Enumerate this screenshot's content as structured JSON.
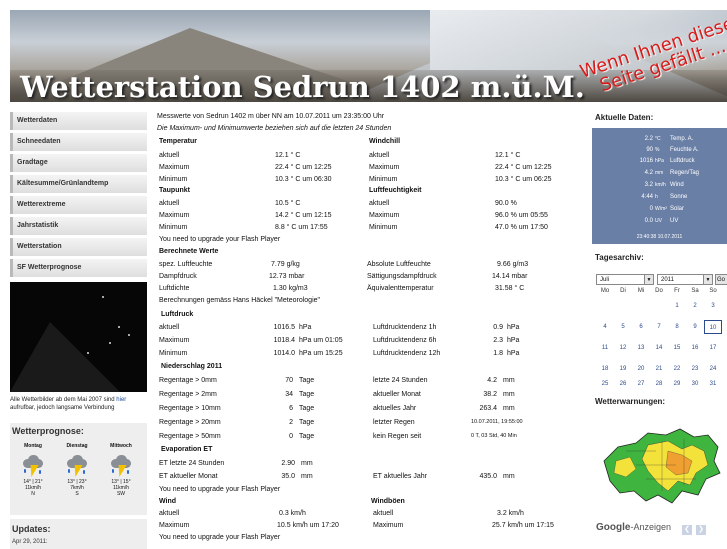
{
  "banner": {
    "title": "Wetterstation Sedrun 1402 m.ü.M.",
    "like_text": "Wenn Ihnen diese Seite gefällt ..."
  },
  "nav": [
    "Wetterdaten",
    "Schneedaten",
    "Gradtage",
    "Kältesumme/Grünlandtemp",
    "Wetterextreme",
    "Jahrstatistik",
    "Wetterstation",
    "SF Wetterprognose"
  ],
  "webcam": {
    "caption_pre": "Alle Wetterbilder ab dem Mai 2007 sind",
    "caption_link": "hier",
    "caption_post": "aufrufbar, jedoch langsame Verbindung"
  },
  "prognose": {
    "title": "Wetterprognose:",
    "days": [
      {
        "day": "Montag",
        "temp": "14° | 21°",
        "wind": "11km/h",
        "dir": "N"
      },
      {
        "day": "Dienstag",
        "temp": "13° | 23°",
        "wind": "7km/h",
        "dir": "S"
      },
      {
        "day": "Mittwoch",
        "temp": "13° | 15°",
        "wind": "11km/h",
        "dir": "SW"
      }
    ]
  },
  "updates": {
    "title": "Updates:",
    "date": "Apr 29, 2011:"
  },
  "main": {
    "intro1": "Messwerte von Sedrun 1402 m über NN am 10.07.2011 um 23:35:00 Uhr",
    "intro2": "Die Maximum- und Minimumwerte beziehen sich auf die letzten 24 Stunden",
    "flash": "You need to upgrade your Flash Player",
    "temperatur": {
      "h": "Temperatur",
      "rows": [
        [
          "aktuell",
          "12.1 ° C",
          ""
        ],
        [
          "Maximum",
          "22.4 ° C um 12:25",
          ""
        ],
        [
          "Minimum",
          "10.3 ° C um 06:30",
          ""
        ]
      ]
    },
    "windchill": {
      "h": "Windchill",
      "rows": [
        [
          "aktuell",
          "12.1 ° C"
        ],
        [
          "Maximum",
          "22.4 ° C um 12:25"
        ],
        [
          "Minimum",
          "10.3 ° C um 06:25"
        ]
      ]
    },
    "taupunkt": {
      "h": "Taupunkt",
      "rows": [
        [
          "aktuell",
          "10.5 ° C"
        ],
        [
          "Maximum",
          "14.2 ° C um 12:15"
        ],
        [
          "Minimum",
          "8.8 ° C um 17:55"
        ]
      ]
    },
    "feuchte": {
      "h": "Luftfeuchtigkeit",
      "rows": [
        [
          "aktuell",
          "90.0 %"
        ],
        [
          "Maximum",
          "96.0 % um 05:55"
        ],
        [
          "Minimum",
          "47.0 % um 17:50"
        ]
      ]
    },
    "berechnet": {
      "h": "Berechnete Werte",
      "left": [
        [
          "spez. Luftfeuchte",
          "7.79 g/kg"
        ],
        [
          "Dampfdruck",
          "12.73 mbar"
        ],
        [
          "Luftdichte",
          "1.30 kg/m3"
        ]
      ],
      "right": [
        [
          "Absolute Luftfeuchte",
          "9.66 g/m3"
        ],
        [
          "Sättigungsdampfdruck",
          "14.14 mbar"
        ],
        [
          "Äquivalenttemperatur",
          "31.58 ° C"
        ]
      ],
      "note": "Berechnungen gemäss Hans Häckel \"Meteorologie\""
    },
    "luftdruck": {
      "h": "Luftdruck",
      "left": [
        [
          "aktuell",
          "1016.5",
          "hPa"
        ],
        [
          "Maximum",
          "1018.4",
          "hPa um 01:05"
        ],
        [
          "Minimum",
          "1014.0",
          "hPa um 15:25"
        ]
      ],
      "right": [
        [
          "Luftdrucktendenz 1h",
          "0.9",
          "hPa"
        ],
        [
          "Luftdrucktendenz 6h",
          "2.3",
          "hPa"
        ],
        [
          "Luftdrucktendenz 12h",
          "1.8",
          "hPa"
        ]
      ]
    },
    "niederschlag": {
      "h": "Niederschlag 2011",
      "left": [
        [
          "Regentage > 0mm",
          "70",
          "Tage"
        ],
        [
          "Regentage > 2mm",
          "34",
          "Tage"
        ],
        [
          "Regentage > 10mm",
          "6",
          "Tage"
        ],
        [
          "Regentage > 20mm",
          "2",
          "Tage"
        ],
        [
          "Regentage > 50mm",
          "0",
          "Tage"
        ]
      ],
      "right": [
        [
          "letzte 24 Stunden",
          "4.2",
          "mm"
        ],
        [
          "aktueller Monat",
          "38.2",
          "mm"
        ],
        [
          "aktuelles Jahr",
          "263.4",
          "mm"
        ],
        [
          "letzter Regen",
          "10.07.2011, 19:55:00",
          ""
        ],
        [
          "kein Regen seit",
          "0 T, 03 Std, 40 Min",
          ""
        ]
      ]
    },
    "evaporation": {
      "h": "Evaporation ET",
      "left": [
        [
          "ET letzte 24 Stunden",
          "2.90",
          "mm"
        ],
        [
          "ET aktueller Monat",
          "35.0",
          "mm"
        ]
      ],
      "right": [
        [
          "ET aktuelles Jahr",
          "435.0",
          "mm"
        ]
      ]
    },
    "wind": {
      "h": "Wind",
      "rows": [
        [
          "aktuell",
          "0.3 km/h"
        ],
        [
          "Maximum",
          "10.5 km/h um 17:20"
        ]
      ]
    },
    "windboeen": {
      "h": "Windböen",
      "rows": [
        [
          "aktuell",
          "3.2 km/h"
        ],
        [
          "Maximum",
          "25.7 km/h um 17:15"
        ]
      ]
    }
  },
  "aktuell": {
    "title": "Aktuelle Daten:",
    "rows": [
      {
        "v": "2.2",
        "u": "°C",
        "l": "Temp. A."
      },
      {
        "v": "90",
        "u": "%",
        "l": "Feuchte A."
      },
      {
        "v": "1016",
        "u": "hPa",
        "l": "Luftdruck"
      },
      {
        "v": "4.2",
        "u": "mm",
        "l": "Regen/Tag"
      },
      {
        "v": "3.2",
        "u": "km/h",
        "l": "Wind"
      },
      {
        "v": "4:44",
        "u": "h",
        "l": "Sonne"
      },
      {
        "v": "0",
        "u": "W/m²",
        "l": "Solar"
      },
      {
        "v": "0.0",
        "u": "UV",
        "l": "UV"
      }
    ],
    "footer": "23:40:38   10.07.2011"
  },
  "archiv": {
    "title": "Tagesarchiv:",
    "month": "Juli",
    "year": "2011",
    "go": "Go",
    "weekdays": [
      "Mo",
      "Di",
      "Mi",
      "Do",
      "Fr",
      "Sa",
      "So"
    ],
    "weeks": [
      [
        "",
        "",
        "",
        "",
        "1",
        "2",
        "3"
      ],
      [
        "4",
        "5",
        "6",
        "7",
        "8",
        "9",
        "10"
      ],
      [
        "11",
        "12",
        "13",
        "14",
        "15",
        "16",
        "17"
      ],
      [
        "18",
        "19",
        "20",
        "21",
        "22",
        "23",
        "24"
      ],
      [
        "25",
        "26",
        "27",
        "28",
        "29",
        "30",
        "31"
      ]
    ]
  },
  "warnungen": {
    "title": "Wetterwarnungen:"
  },
  "ads": {
    "google": "Google",
    "label": "-Anzeigen"
  }
}
